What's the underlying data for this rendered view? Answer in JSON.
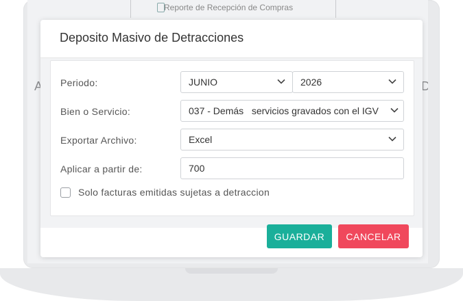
{
  "background": {
    "menu_item_label": "Reporte de Recepción de Compras",
    "edge_letters": [
      "A",
      "D"
    ]
  },
  "modal": {
    "title": "Deposito Masivo de Detracciones",
    "form": {
      "periodo_label": "Periodo:",
      "month_value": "JUNIO",
      "year_value": "2026",
      "bien_label": "Bien o Servicio:",
      "bien_value": "037 - Demás   servicios gravados con el IGV",
      "exportar_label": "Exportar Archivo:",
      "exportar_value": "Excel",
      "aplicar_label": "Aplicar a partir de:",
      "aplicar_value": "700",
      "checkbox_label": "Solo facturas emitidas sujetas a detraccion",
      "checkbox_checked": false
    },
    "buttons": {
      "save_label": "GUARDAR",
      "cancel_label": "CANCELAR"
    }
  },
  "colors": {
    "save": "#1aaf9a",
    "cancel": "#f0485c"
  },
  "icons": [
    "chevron-down-icon",
    "document-icon"
  ]
}
